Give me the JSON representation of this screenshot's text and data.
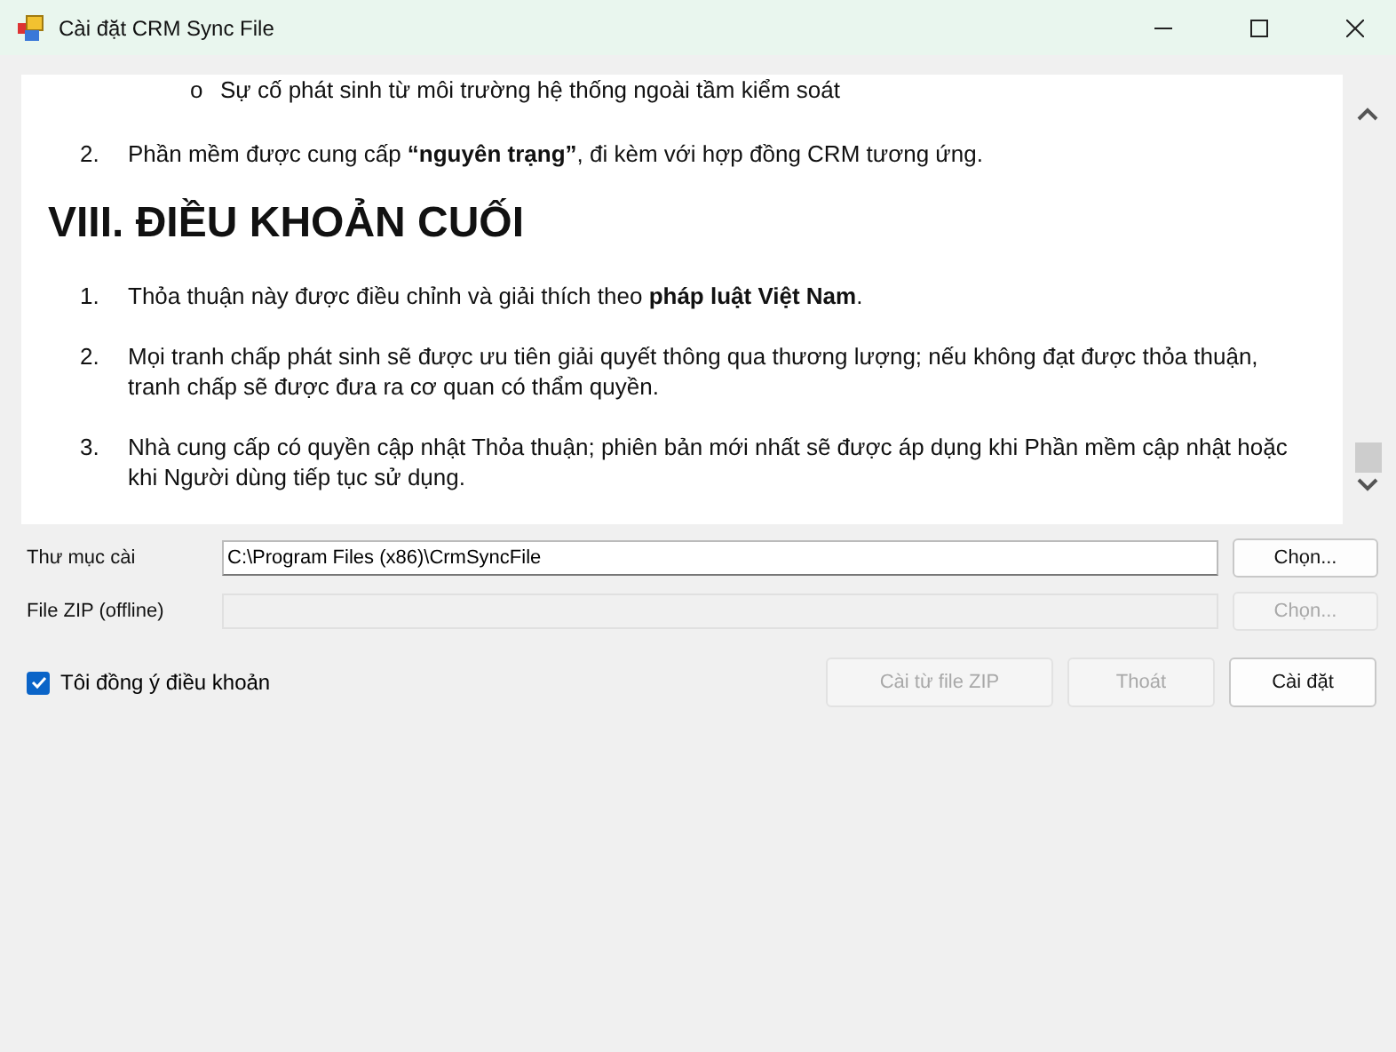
{
  "window": {
    "title": "Cài đặt CRM Sync File"
  },
  "document": {
    "blocks": [
      {
        "kind": "subitem",
        "marker": "o",
        "text": "Sự cố phát sinh từ môi trường hệ thống ngoài tầm kiểm soát"
      },
      {
        "kind": "item",
        "marker": "2.",
        "text": "Phần mềm được cung cấp **“nguyên trạng”**, đi kèm với hợp đồng CRM tương ứng."
      },
      {
        "kind": "heading",
        "text": "VIII. ĐIỀU KHOẢN CUỐI"
      },
      {
        "kind": "item",
        "marker": "1.",
        "text": "Thỏa thuận này được điều chỉnh và giải thích theo **pháp luật Việt Nam**."
      },
      {
        "kind": "item",
        "marker": "2.",
        "text": "Mọi tranh chấp phát sinh sẽ được ưu tiên giải quyết thông qua thương lượng; nếu không đạt được thỏa thuận, tranh chấp sẽ được đưa ra cơ quan có thẩm quyền."
      },
      {
        "kind": "item",
        "marker": "3.",
        "text": "Nhà cung cấp có quyền cập nhật Thỏa thuận; phiên bản mới nhất sẽ được áp dụng khi Phần mềm cập nhật hoặc khi Người dùng tiếp tục sử dụng."
      }
    ]
  },
  "fields": [
    {
      "label": "Thư mục cài",
      "value": "C:\\Program Files (x86)\\CrmSyncFile",
      "disabled": false,
      "button": "Chọn..."
    },
    {
      "label": "File ZIP (offline)",
      "disabled": true,
      "button": "Chọn..."
    }
  ],
  "agree": {
    "label": "Tôi đồng ý điều khoản",
    "checked": true
  },
  "buttons": [
    {
      "label": "Cài từ file ZIP",
      "disabled": true
    },
    {
      "label": "Thoát",
      "disabled": true
    },
    {
      "label": "Cài đặt",
      "disabled": false
    }
  ]
}
